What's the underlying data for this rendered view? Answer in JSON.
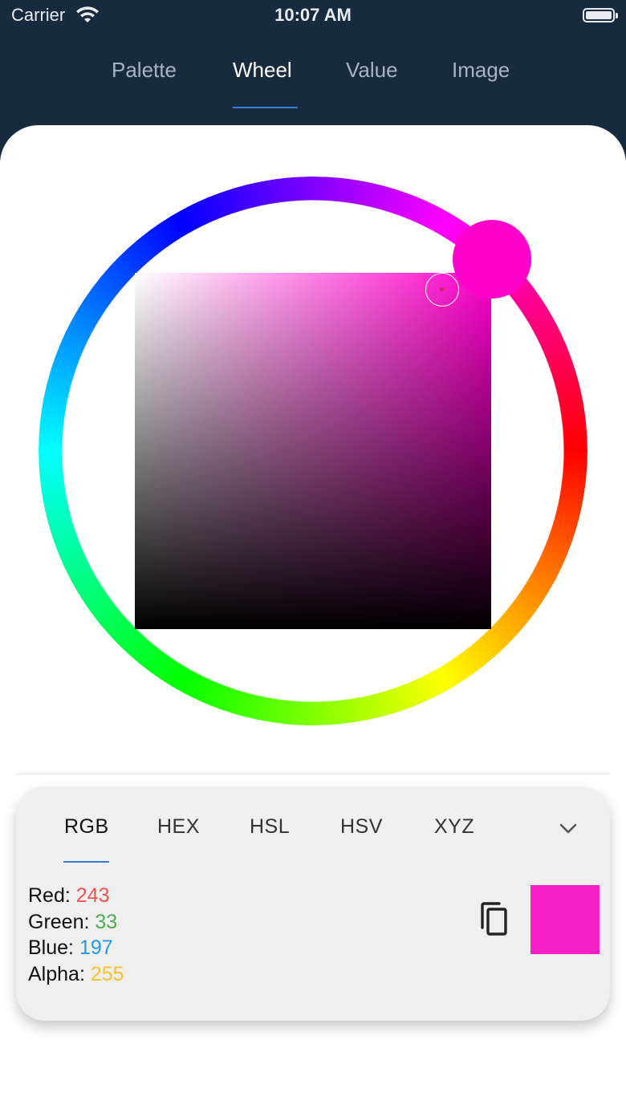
{
  "status_bar": {
    "carrier": "Carrier",
    "time": "10:07 AM"
  },
  "tabs": [
    {
      "label": "Palette",
      "active": false
    },
    {
      "label": "Wheel",
      "active": true
    },
    {
      "label": "Value",
      "active": false
    },
    {
      "label": "Image",
      "active": false
    }
  ],
  "colors": {
    "header_bg": "#172a3e",
    "accent": "#3a7bd5",
    "selected_hue": "#ff00cc",
    "selected_color": "#f321c5",
    "red_value": "#ef5350",
    "green_value": "#4caf50",
    "blue_value": "#2196f3",
    "alpha_value": "#fbc02d"
  },
  "format_tabs": [
    {
      "label": "RGB",
      "active": true
    },
    {
      "label": "HEX",
      "active": false
    },
    {
      "label": "HSL",
      "active": false
    },
    {
      "label": "HSV",
      "active": false
    },
    {
      "label": "XYZ",
      "active": false
    }
  ],
  "values": {
    "red_label": "Red:",
    "red": "243",
    "green_label": "Green:",
    "green": "33",
    "blue_label": "Blue:",
    "blue": "197",
    "alpha_label": "Alpha:",
    "alpha": "255"
  },
  "icons": {
    "expand": "chevron-down-icon",
    "copy": "copy-icon"
  }
}
